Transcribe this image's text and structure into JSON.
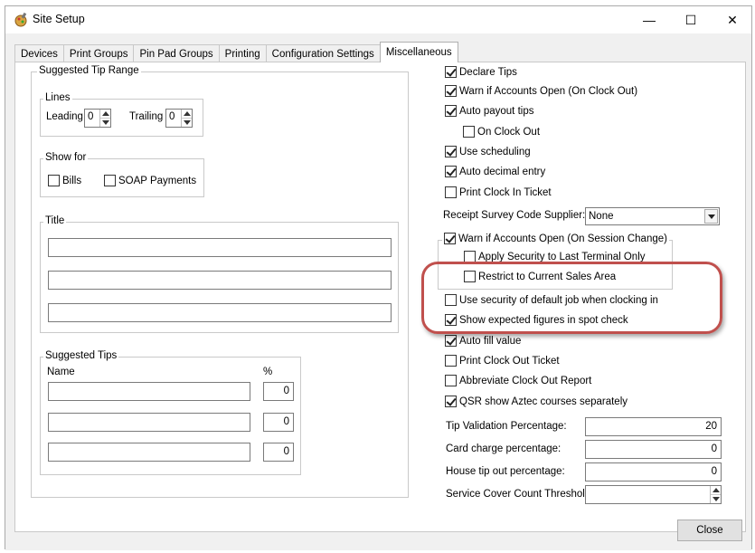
{
  "window": {
    "title": "Site Setup",
    "controls": {
      "minimize": "—",
      "maximize": "☐",
      "close": "✕"
    }
  },
  "tabs": [
    {
      "label": "Devices"
    },
    {
      "label": "Print Groups"
    },
    {
      "label": "Pin Pad Groups"
    },
    {
      "label": "Printing"
    },
    {
      "label": "Configuration Settings"
    },
    {
      "label": "Miscellaneous",
      "active": true
    }
  ],
  "tip_range": {
    "legend": "Suggested Tip Range",
    "lines": {
      "legend": "Lines",
      "leading_label": "Leading",
      "leading_value": "0",
      "trailing_label": "Trailing",
      "trailing_value": "0"
    },
    "show_for": {
      "legend": "Show for",
      "bills_label": "Bills",
      "bills_checked": false,
      "soap_label": "SOAP Payments",
      "soap_checked": false
    },
    "title": {
      "legend": "Title",
      "values": [
        "",
        "",
        ""
      ]
    },
    "suggested_tips": {
      "legend": "Suggested Tips",
      "name_header": "Name",
      "percent_header": "%",
      "rows": [
        {
          "name": "",
          "percent": "0"
        },
        {
          "name": "",
          "percent": "0"
        },
        {
          "name": "",
          "percent": "0"
        }
      ]
    }
  },
  "options": {
    "declare_tips": {
      "label": "Declare Tips",
      "checked": true
    },
    "warn_clock_out": {
      "label": "Warn if Accounts Open (On Clock Out)",
      "checked": true
    },
    "auto_payout_tips": {
      "label": "Auto payout tips",
      "checked": true
    },
    "on_clock_out": {
      "label": "On Clock Out",
      "checked": false
    },
    "use_scheduling": {
      "label": "Use scheduling",
      "checked": true
    },
    "auto_decimal": {
      "label": "Auto decimal entry",
      "checked": true
    },
    "print_clock_in": {
      "label": "Print Clock In Ticket",
      "checked": false
    },
    "receipt_survey": {
      "label": "Receipt Survey Code Supplier:",
      "value": "None"
    },
    "warn_session": {
      "label": "Warn if Accounts Open (On Session Change)",
      "checked": true
    },
    "apply_security": {
      "label": "Apply Security to Last Terminal Only",
      "checked": false
    },
    "restrict_sales": {
      "label": "Restrict to Current Sales Area",
      "checked": false
    },
    "default_job": {
      "label": "Use security of default job when clocking in",
      "checked": false
    },
    "expected_figures": {
      "label": "Show expected figures in spot check",
      "checked": true
    },
    "auto_fill": {
      "label": "Auto fill value",
      "checked": true
    },
    "print_clock_out": {
      "label": "Print Clock Out Ticket",
      "checked": false
    },
    "abbreviate_report": {
      "label": "Abbreviate Clock Out Report",
      "checked": false
    },
    "qsr_courses": {
      "label": "QSR show Aztec courses separately",
      "checked": true
    },
    "tip_validation": {
      "label": "Tip Validation Percentage:",
      "value": "20"
    },
    "card_charge": {
      "label": "Card charge percentage:",
      "value": "0"
    },
    "house_tip": {
      "label": "House tip out percentage:",
      "value": "0"
    },
    "service_cover": {
      "label": "Service Cover Count Threshold:",
      "value": ""
    }
  },
  "footer": {
    "close_label": "Close"
  },
  "colors": {
    "highlight": "#c0504d"
  }
}
